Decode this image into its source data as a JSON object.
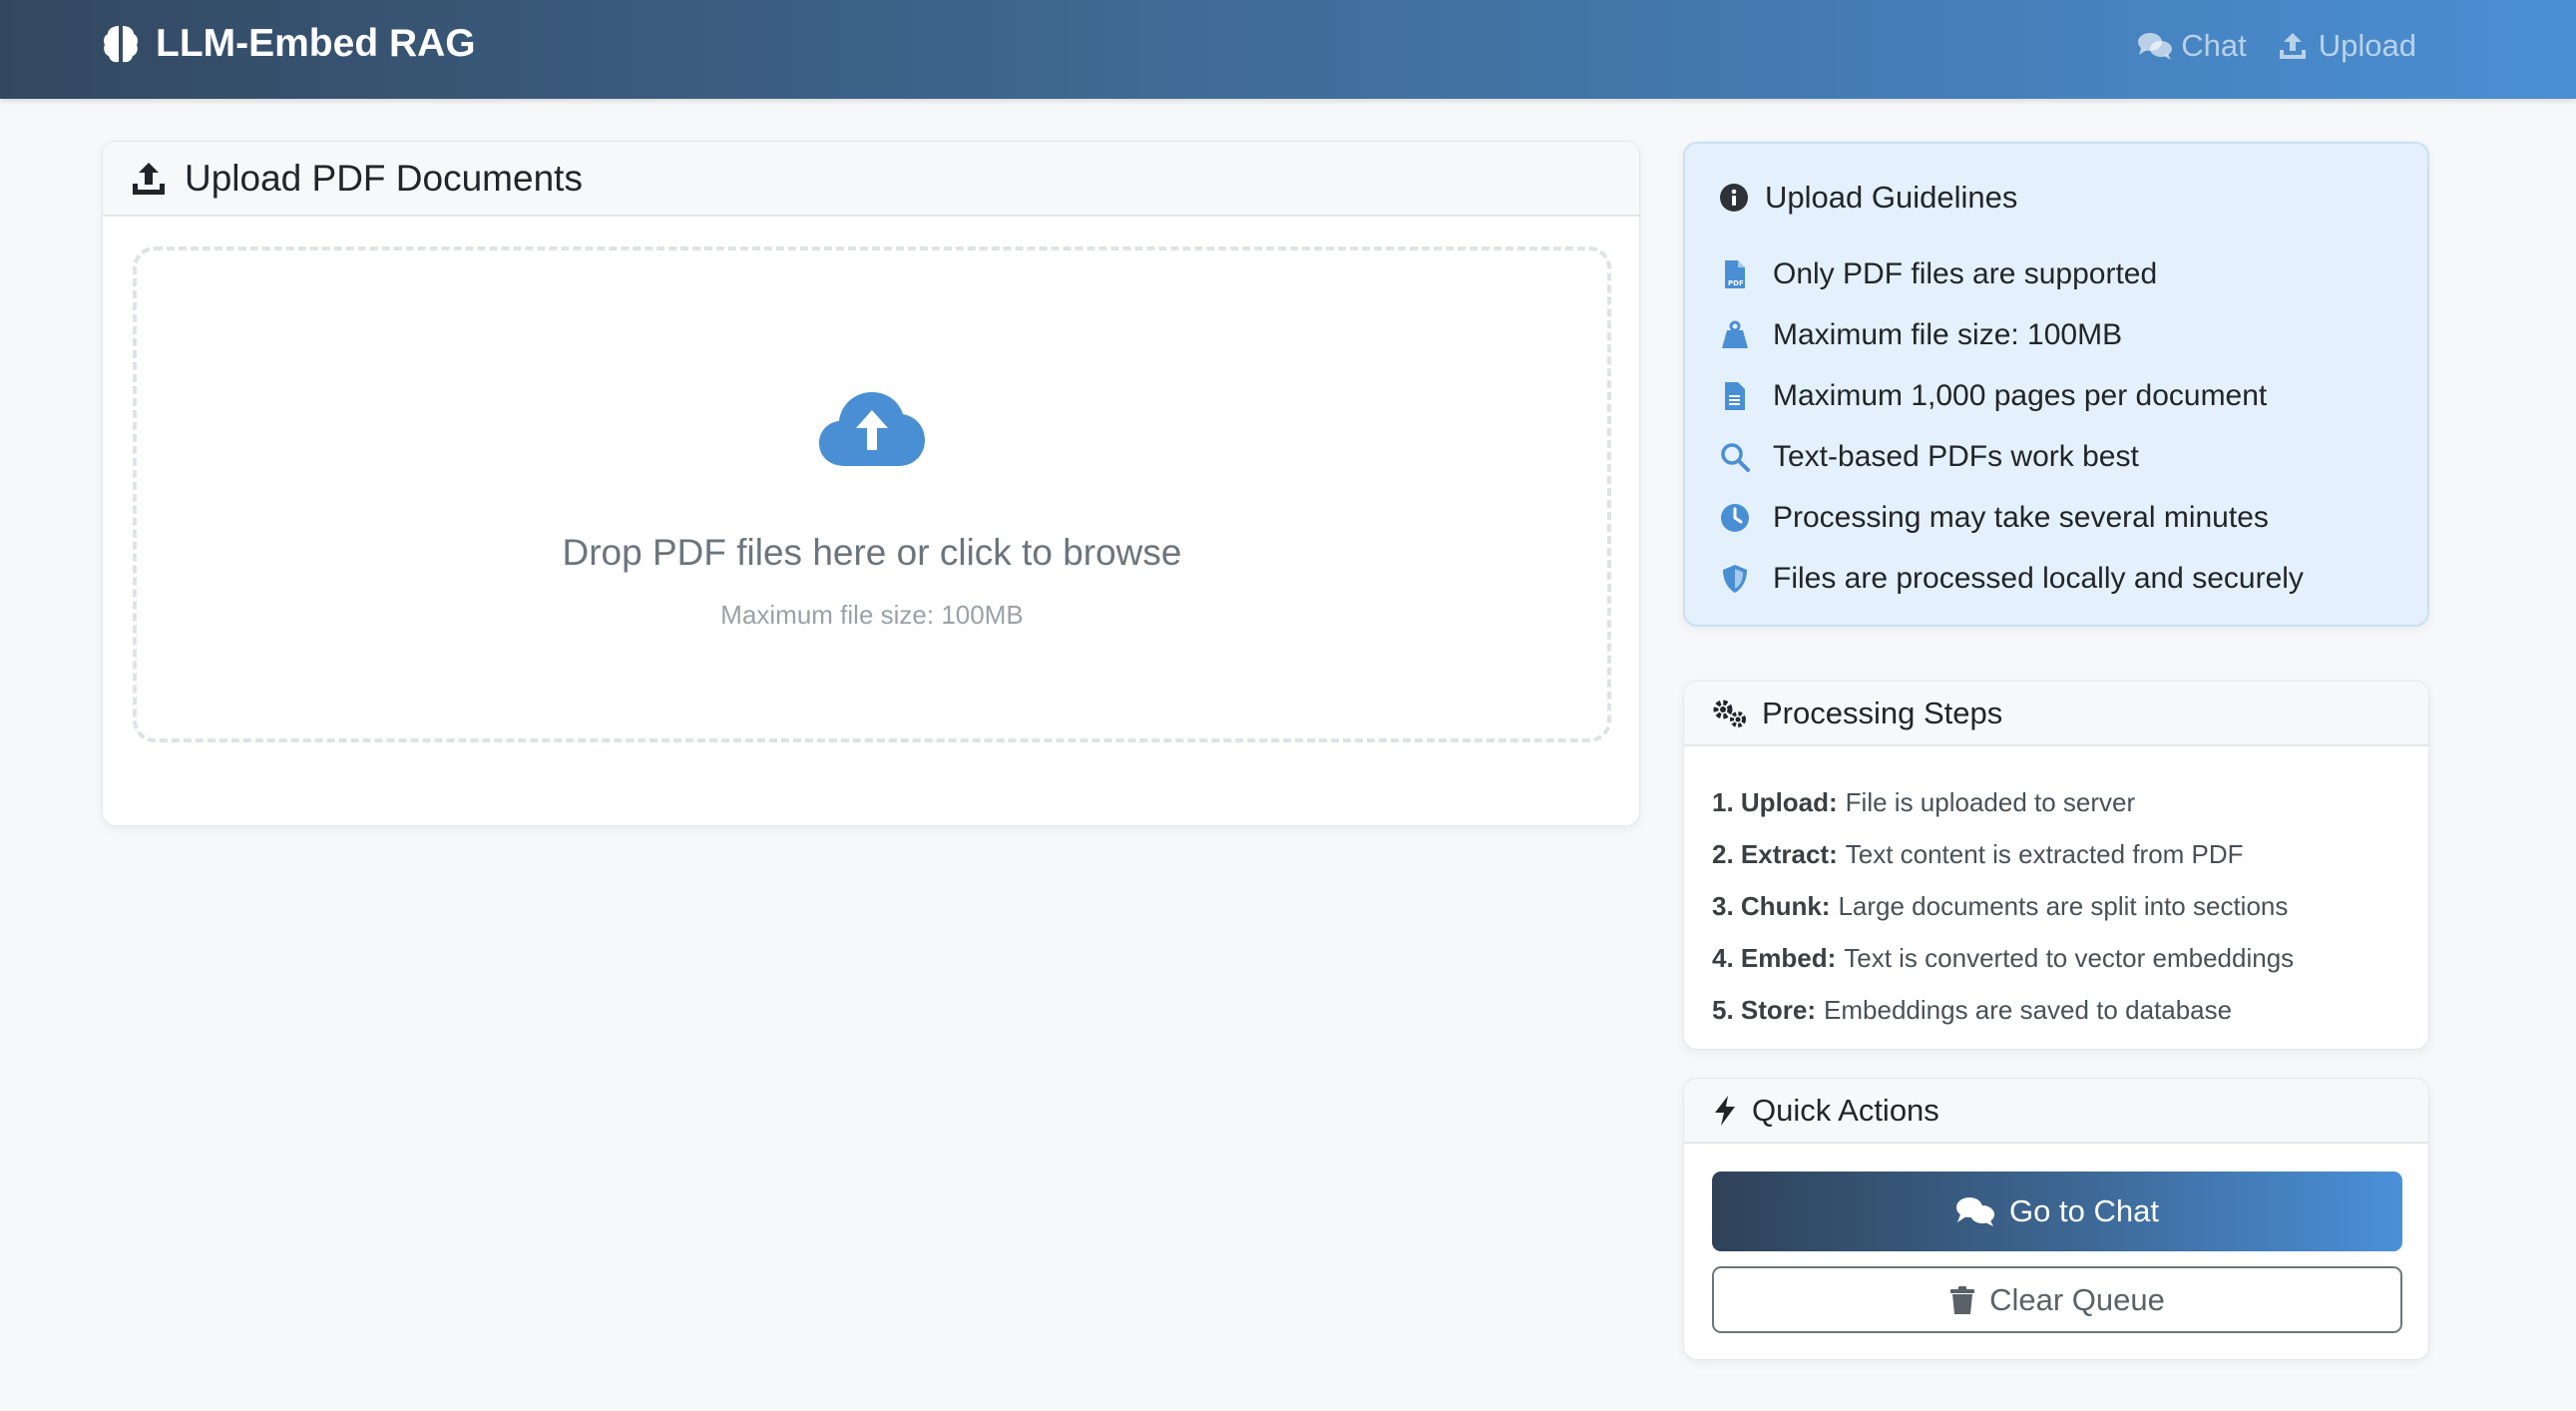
{
  "navbar": {
    "brand": "LLM-Embed RAG",
    "brand_icon": "brain-icon",
    "links": [
      {
        "label": "Chat",
        "icon": "comments-icon"
      },
      {
        "label": "Upload",
        "icon": "upload-icon"
      }
    ]
  },
  "upload_card": {
    "title": "Upload PDF Documents",
    "dropzone": {
      "icon": "cloud-upload-icon",
      "title": "Drop PDF files here or click to browse",
      "subtitle": "Maximum file size: 100MB"
    }
  },
  "guidelines": {
    "title": "Upload Guidelines",
    "items": [
      {
        "text": "Only PDF files are supported",
        "icon": "file-pdf-icon"
      },
      {
        "text": "Maximum file size: 100MB",
        "icon": "weight-icon"
      },
      {
        "text": "Maximum 1,000 pages per document",
        "icon": "file-alt-icon"
      },
      {
        "text": "Text-based PDFs work best",
        "icon": "search-icon"
      },
      {
        "text": "Processing may take several minutes",
        "icon": "clock-icon"
      },
      {
        "text": "Files are processed locally and securely",
        "icon": "shield-icon"
      }
    ]
  },
  "steps": {
    "title": "Processing Steps",
    "items": [
      {
        "label": "1. Upload:",
        "text": "File is uploaded to server"
      },
      {
        "label": "2. Extract:",
        "text": "Text content is extracted from PDF"
      },
      {
        "label": "3. Chunk:",
        "text": "Large documents are split into sections"
      },
      {
        "label": "4. Embed:",
        "text": "Text is converted to vector embeddings"
      },
      {
        "label": "5. Store:",
        "text": "Embeddings are saved to database"
      }
    ]
  },
  "actions": {
    "title": "Quick Actions",
    "go_chat": "Go to Chat",
    "clear_queue": "Clear Queue"
  },
  "colors": {
    "accent": "#4a90d9",
    "nav_dark": "#334860",
    "guide_bg": "#e4f0fb"
  }
}
